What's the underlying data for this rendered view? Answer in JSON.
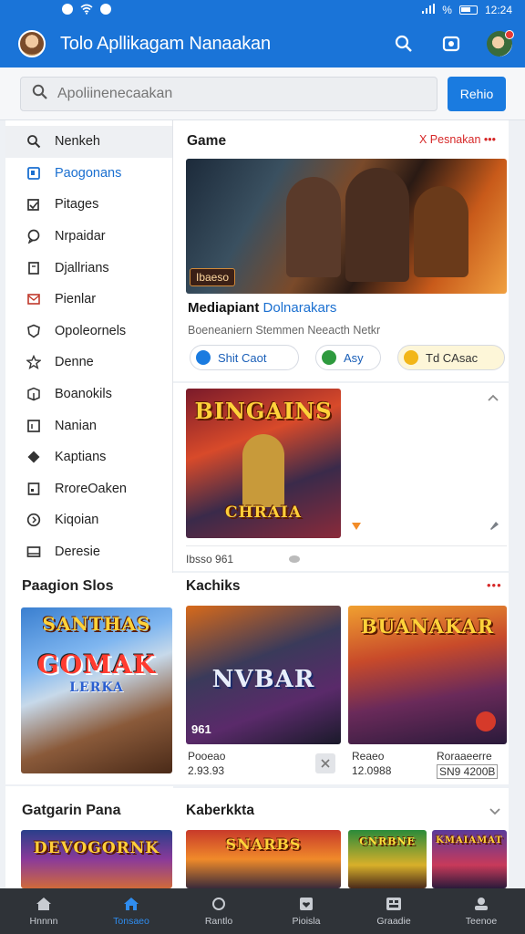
{
  "status_bar": {
    "time": "12:24",
    "battery": "%"
  },
  "app": {
    "title": "Tolo Apllikagam Nanaakan"
  },
  "search": {
    "placeholder": "Apoliinenecaakan",
    "button_label": "Rehio"
  },
  "sidebar": {
    "items": [
      {
        "label": "Nenkeh",
        "icon": "search-icon"
      },
      {
        "label": "Paogonans",
        "icon": "bookmark-icon"
      },
      {
        "label": "Pitages",
        "icon": "tag-icon"
      },
      {
        "label": "Nrpaidar",
        "icon": "chat-icon"
      },
      {
        "label": "Djallrians",
        "icon": "book-icon"
      },
      {
        "label": "Pienlar",
        "icon": "mail-icon"
      },
      {
        "label": "Opoleornels",
        "icon": "shield-icon"
      },
      {
        "label": "Denne",
        "icon": "star-icon"
      },
      {
        "label": "Boanokils",
        "icon": "box-icon"
      },
      {
        "label": "Nanian",
        "icon": "calendar-icon"
      },
      {
        "label": "Kaptians",
        "icon": "diamond-icon"
      },
      {
        "label": "RroreOaken",
        "icon": "document-icon"
      },
      {
        "label": "Kiqoian",
        "icon": "clock-icon"
      },
      {
        "label": "Deresie",
        "icon": "card-icon"
      }
    ]
  },
  "left_sections": [
    {
      "title": "Paagion Slos",
      "card_title": "SANTHAS",
      "card_subtitle": "GOMAK",
      "card_sub2": "LERKA"
    },
    {
      "title": "Gatgarin Pana",
      "card_title": "DEVOGORNK"
    }
  ],
  "featured": {
    "section_title": "Game",
    "link_label": "X Pesnakan",
    "badge": "Ibaeso",
    "name": "Mediapiant",
    "name_accent": "Dolnarakars",
    "subtitle": "Boeneaniern Stemmen Neeacth Netkr",
    "pills": [
      {
        "label": "Shit Caot",
        "color": "#1a7be0"
      },
      {
        "label": "Asy",
        "color": "#2e9a3e"
      },
      {
        "label": "Td CAsac",
        "color": "#f2b619"
      }
    ]
  },
  "game2": {
    "art_title": "BINGAINS",
    "art_subtitle": "CHRAIA",
    "caption": "Ibsso 961"
  },
  "kachiks": {
    "section_title": "Kachiks",
    "cards": [
      {
        "art": "NVBAR",
        "badge": "961",
        "name": "Pooeao",
        "meta": "2.93.93"
      },
      {
        "art": "BUANAKAR",
        "name": "Reaeo",
        "meta": "12.0988",
        "extra_name": "Roraaeerre",
        "extra_meta": "SN9 4200B"
      }
    ]
  },
  "kaberkkta": {
    "section_title": "Kaberkkta",
    "cards": [
      "SNARBS",
      "CNRBNE",
      "KMAIAMAT"
    ]
  },
  "bottom_nav": [
    {
      "label": "Hnnnn",
      "icon": "home-icon"
    },
    {
      "label": "Tonsaeo",
      "icon": "home-active-icon"
    },
    {
      "label": "Rantlo",
      "icon": "refresh-icon"
    },
    {
      "label": "Pioisla",
      "icon": "heart-icon"
    },
    {
      "label": "Graadie",
      "icon": "grid-icon"
    },
    {
      "label": "Teenoe",
      "icon": "user-icon"
    }
  ]
}
